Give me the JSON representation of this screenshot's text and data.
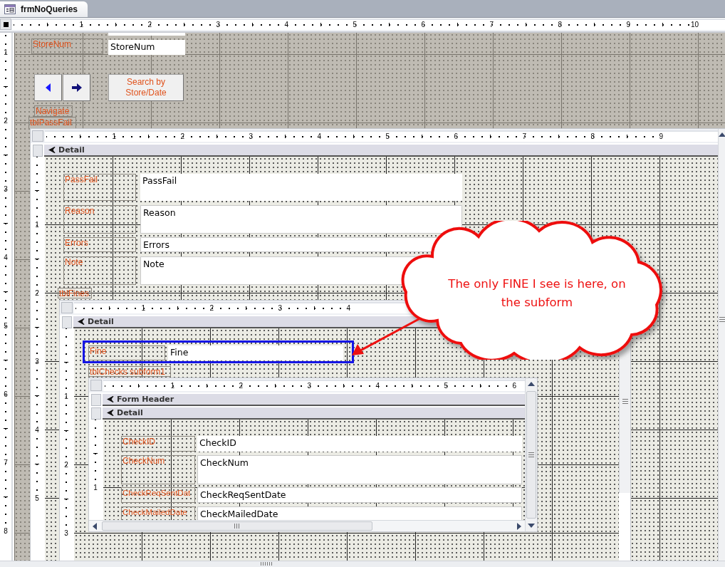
{
  "tab": {
    "title": "frmNoQueries",
    "selected": true
  },
  "ruler": [
    "1",
    "2",
    "3",
    "4",
    "5",
    "6",
    "7",
    "8",
    "9",
    "10"
  ],
  "vertical_ruler": [
    "1",
    "2",
    "3",
    "4",
    "5",
    "6",
    "7",
    "8"
  ],
  "controls": [
    {
      "kind": "label",
      "text": "StoreNum"
    },
    {
      "kind": "textbox",
      "text": "StoreNum"
    },
    {
      "kind": "prev_button"
    },
    {
      "kind": "next_button"
    },
    {
      "kind": "button",
      "text": "Search by Store/Date"
    },
    {
      "kind": "label",
      "text": "Navigate"
    },
    {
      "kind": "label",
      "text": "tblPassFail"
    }
  ],
  "subform": {
    "ruler": [
      "1",
      "2",
      "3",
      "4",
      "5",
      "6",
      "7",
      "8",
      "9"
    ],
    "vertical_ruler": [
      "1",
      "2",
      "3",
      "4",
      "5"
    ],
    "sections": [
      {
        "title": "Detail"
      }
    ],
    "controls": [
      {
        "kind": "label",
        "text": "PassFail"
      },
      {
        "kind": "textbox",
        "text": "PassFail"
      },
      {
        "kind": "label",
        "text": "Reason"
      },
      {
        "kind": "textbox",
        "text": "Reason"
      },
      {
        "kind": "label",
        "text": "Errors"
      },
      {
        "kind": "textbox",
        "text": "Errors"
      },
      {
        "kind": "label",
        "text": "Note"
      },
      {
        "kind": "textbox",
        "text": "Note"
      },
      {
        "kind": "label",
        "text": "tblFines"
      }
    ],
    "subform": {
      "ruler": [
        "1",
        "2",
        "3",
        "4"
      ],
      "vertical_ruler": [
        "1",
        "2",
        "3"
      ],
      "sections": [
        {
          "title": "Detail"
        }
      ],
      "controls": [
        {
          "kind": "label",
          "text": "Fine"
        },
        {
          "kind": "textbox",
          "text": "Fine"
        },
        {
          "kind": "label",
          "text": "tblChecks subform1"
        }
      ],
      "subform": {
        "ruler": [
          "1",
          "2",
          "3",
          "4",
          "5",
          "6"
        ],
        "vertical_ruler": [
          "1"
        ],
        "sections": [
          {
            "title": "Form Header"
          },
          {
            "title": "Detail"
          }
        ],
        "controls": [
          {
            "kind": "label",
            "text": "CheckID"
          },
          {
            "kind": "textbox",
            "text": "CheckID"
          },
          {
            "kind": "label",
            "text": "CheckNum"
          },
          {
            "kind": "textbox",
            "text": "CheckNum"
          },
          {
            "kind": "label",
            "text": "CheckReqSentDat"
          },
          {
            "kind": "textbox",
            "text": "CheckReqSentDate"
          },
          {
            "kind": "label",
            "text": "CheckMailedDate"
          },
          {
            "kind": "textbox",
            "text": "CheckMailedDate"
          }
        ]
      }
    }
  },
  "callout": {
    "text": "The only FINE I see is here, on the subform"
  }
}
